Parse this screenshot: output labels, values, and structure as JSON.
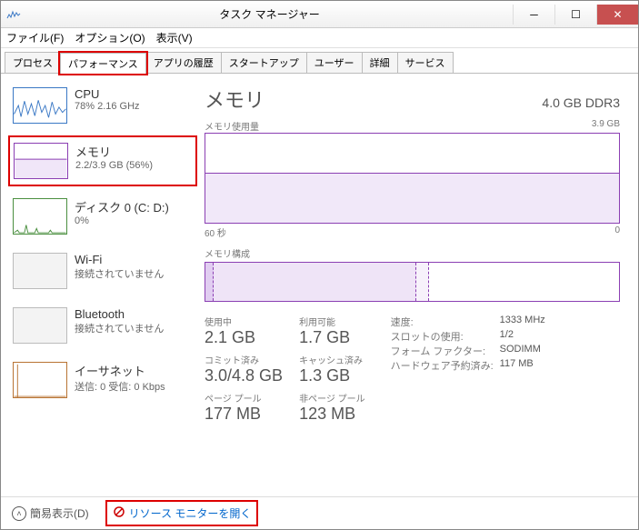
{
  "window": {
    "title": "タスク マネージャー"
  },
  "menu": {
    "file": "ファイル(F)",
    "options": "オプション(O)",
    "view": "表示(V)"
  },
  "tabs": [
    "プロセス",
    "パフォーマンス",
    "アプリの履歴",
    "スタートアップ",
    "ユーザー",
    "詳細",
    "サービス"
  ],
  "sidebar": {
    "cpu": {
      "name": "CPU",
      "val": "78% 2.16 GHz"
    },
    "memory": {
      "name": "メモリ",
      "val": "2.2/3.9 GB (56%)"
    },
    "disk": {
      "name": "ディスク 0 (C: D:)",
      "val": "0%"
    },
    "wifi": {
      "name": "Wi-Fi",
      "val": "接続されていません"
    },
    "bt": {
      "name": "Bluetooth",
      "val": "接続されていません"
    },
    "eth": {
      "name": "イーサネット",
      "val": "送信: 0 受信: 0 Kbps"
    }
  },
  "main": {
    "title": "メモリ",
    "subtitle": "4.0 GB DDR3",
    "usage_label": "メモリ使用量",
    "usage_max": "3.9 GB",
    "x_left": "60 秒",
    "x_right": "0",
    "comp_label": "メモリ構成",
    "stats": {
      "in_use": {
        "lbl": "使用中",
        "val": "2.1 GB"
      },
      "avail": {
        "lbl": "利用可能",
        "val": "1.7 GB"
      },
      "commit": {
        "lbl": "コミット済み",
        "val": "3.0/4.8 GB"
      },
      "cached": {
        "lbl": "キャッシュ済み",
        "val": "1.3 GB"
      },
      "paged": {
        "lbl": "ページ プール",
        "val": "177 MB"
      },
      "nonpaged": {
        "lbl": "非ページ プール",
        "val": "123 MB"
      }
    },
    "kv": {
      "speed": {
        "k": "速度:",
        "v": "1333 MHz"
      },
      "slots": {
        "k": "スロットの使用:",
        "v": "1/2"
      },
      "form": {
        "k": "フォーム ファクター:",
        "v": "SODIMM"
      },
      "hw": {
        "k": "ハードウェア予約済み:",
        "v": "117 MB"
      }
    }
  },
  "footer": {
    "fewer": "簡易表示(D)",
    "resmon": "リソース モニターを開く"
  },
  "chart_data": {
    "type": "area",
    "title": "メモリ使用量",
    "xlabel": "60 秒 → 0",
    "ylabel": "GB",
    "ylim": [
      0,
      3.9
    ],
    "x": [
      60,
      55,
      50,
      45,
      40,
      35,
      30,
      25,
      20,
      15,
      10,
      5,
      0
    ],
    "values": [
      2.2,
      2.2,
      2.2,
      2.2,
      2.2,
      2.2,
      2.2,
      2.2,
      2.2,
      2.2,
      2.2,
      2.2,
      2.2
    ]
  }
}
